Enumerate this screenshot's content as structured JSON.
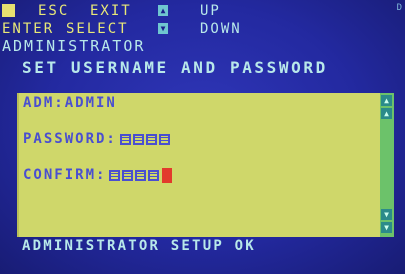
{
  "hints": {
    "esc_key": "ESC",
    "esc_action": "EXIT",
    "up_action": "UP",
    "enter_key": "ENTER",
    "enter_action": "SELECT",
    "down_action": "DOWN"
  },
  "menu": {
    "title": "ADMINISTRATOR",
    "subtitle": "SET USERNAME AND PASSWORD"
  },
  "form": {
    "username_label": "ADM:ADMIN",
    "password_label": "PASSWORD:",
    "confirm_label": "CONFIRM:",
    "password_masked_count": 4,
    "confirm_masked_count": 4
  },
  "status": {
    "message": "ADMINISTRATOR SETUP OK"
  },
  "colors": {
    "screen_bg": "#2329a0",
    "text_cyan": "#b8e8ea",
    "text_yellow": "#e8e878",
    "panel_bg": "#cfd76a",
    "panel_text": "#4a4fd0",
    "scrollbar": "#6cc26a",
    "cursor": "#e23a2c"
  },
  "icons": {
    "up": "up-arrow-icon",
    "down": "down-arrow-icon",
    "scroll_up": "scroll-up-icon",
    "scroll_down": "scroll-down-icon"
  }
}
